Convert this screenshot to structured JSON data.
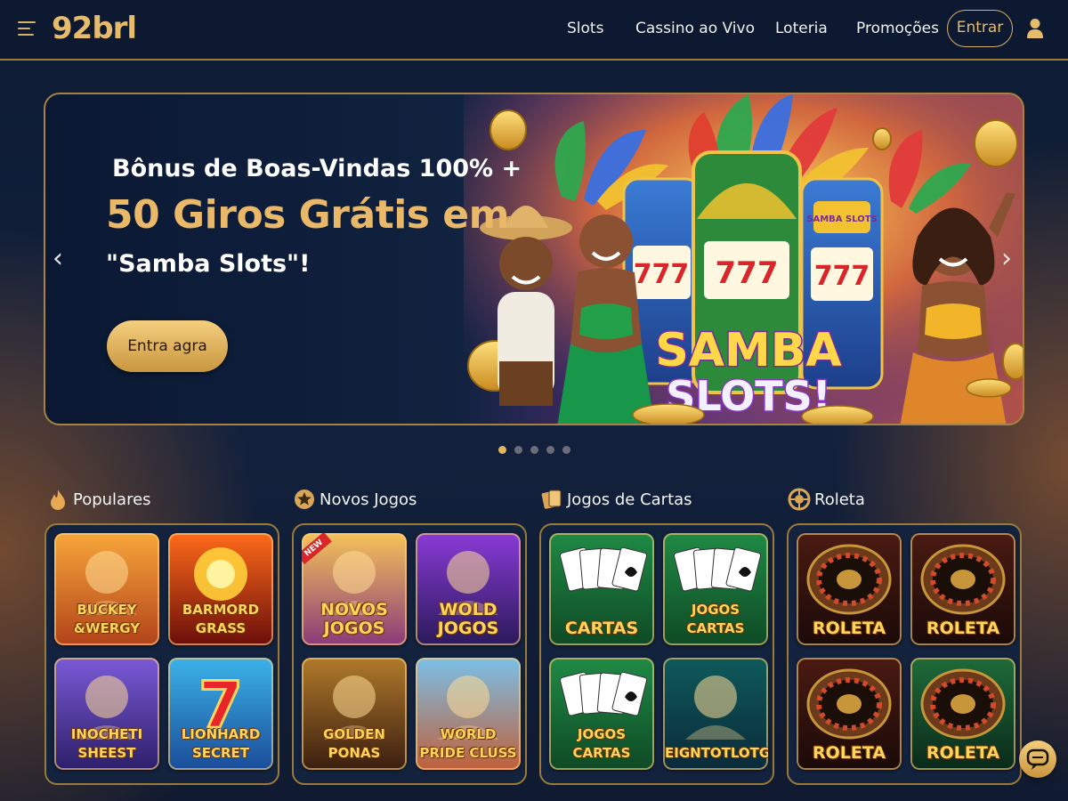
{
  "header": {
    "logo": "92brl",
    "nav": [
      "Slots",
      "Cassino ao Vivo",
      "Loteria",
      "Promoções"
    ],
    "login_label": "Entrar"
  },
  "banner": {
    "line1": "Bônus de Boas-Vindas 100% +",
    "line2": "50 Giros Grátis em",
    "line3": "\"Samba Slots\"!",
    "cta_label": "Entra agra",
    "art_title_top": "SAMBA",
    "art_title_bottom": "SLOTS!",
    "machine_sign": "SAMBA SLOTS",
    "reels": "777",
    "slide_count": 5,
    "active_slide": 1
  },
  "colors": {
    "accent": "#e7bb6c",
    "background": "#12213d",
    "panel_border": "#9a7a3a"
  },
  "categories": [
    {
      "title": "Populares",
      "icon": "flame-icon",
      "games": [
        {
          "label": "BUCKEY\n&WERGY",
          "theme": "lion"
        },
        {
          "label": "BARMORD\nGRASS",
          "theme": "fire"
        },
        {
          "label": "INOCHETI\nSHEEST",
          "theme": "wizard"
        },
        {
          "label": "LIONHARD\nSECRET",
          "theme": "seven"
        }
      ]
    },
    {
      "title": "Novos Jogos",
      "icon": "star-badge-icon",
      "games": [
        {
          "label": "NOVOS\nJOGOS",
          "theme": "angel",
          "badge": "NEW"
        },
        {
          "label": "WOLD\nJOGOS",
          "theme": "parrot"
        },
        {
          "label": "GOLDEN\nPONAS",
          "theme": "zeus"
        },
        {
          "label": "WORLD\nPRIDE CLUSS",
          "theme": "carnival"
        }
      ]
    },
    {
      "title": "Jogos de Cartas",
      "icon": "cards-icon",
      "games": [
        {
          "label": "CARTAS",
          "theme": "cards"
        },
        {
          "label": "JOGOS\nCARTAS",
          "theme": "cards"
        },
        {
          "label": "JOGOS\nCARTAS",
          "theme": "cards"
        },
        {
          "label": "EIGNTOTLOTG",
          "theme": "dealer"
        }
      ]
    },
    {
      "title": "Roleta",
      "icon": "roulette-icon",
      "games": [
        {
          "label": "ROLETA",
          "theme": "roulette"
        },
        {
          "label": "ROLETA",
          "theme": "roulette"
        },
        {
          "label": "ROLETA",
          "theme": "roulette"
        },
        {
          "label": "ROLETA",
          "theme": "roulette-dealer"
        }
      ]
    }
  ]
}
